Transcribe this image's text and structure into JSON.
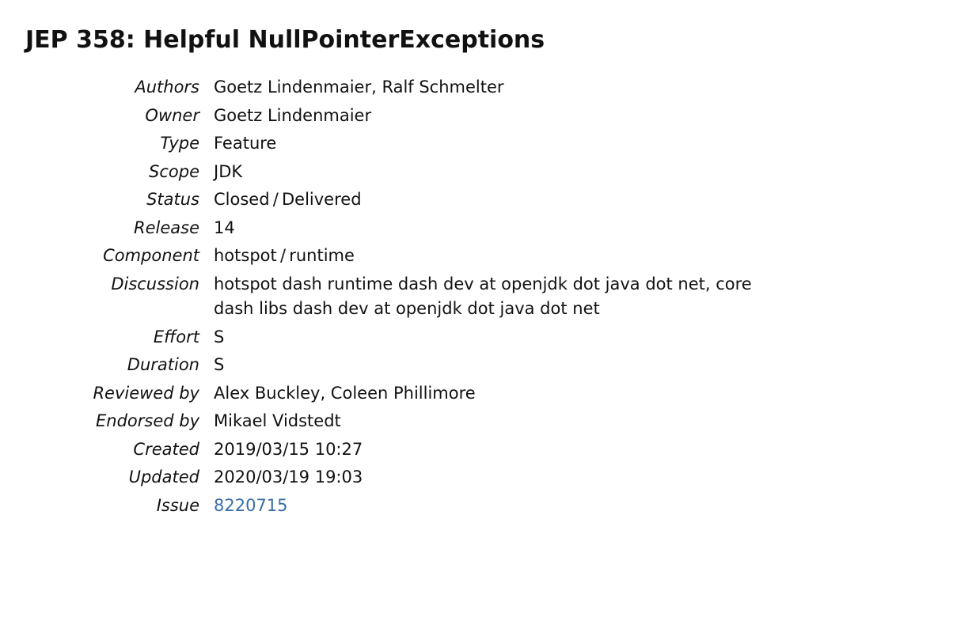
{
  "title": "JEP 358: Helpful NullPointerExceptions",
  "fields": {
    "authors_label": "Authors",
    "authors_value": "Goetz Lindenmaier, Ralf Schmelter",
    "owner_label": "Owner",
    "owner_value": "Goetz Lindenmaier",
    "type_label": "Type",
    "type_value": "Feature",
    "scope_label": "Scope",
    "scope_value": "JDK",
    "status_label": "Status",
    "status_value": "Closed / Delivered",
    "release_label": "Release",
    "release_value": "14",
    "component_label": "Component",
    "component_value": "hotspot / runtime",
    "discussion_label": "Discussion",
    "discussion_value": "hotspot dash runtime dash dev at openjdk dot java dot net, core dash libs dash dev at openjdk dot java dot net",
    "effort_label": "Effort",
    "effort_value": "S",
    "duration_label": "Duration",
    "duration_value": "S",
    "reviewed_by_label": "Reviewed by",
    "reviewed_by_value": "Alex Buckley, Coleen Phillimore",
    "endorsed_by_label": "Endorsed by",
    "endorsed_by_value": "Mikael Vidstedt",
    "created_label": "Created",
    "created_value": "2019/03/15 10:27",
    "updated_label": "Updated",
    "updated_value": "2020/03/19 19:03",
    "issue_label": "Issue",
    "issue_value": "8220715"
  }
}
